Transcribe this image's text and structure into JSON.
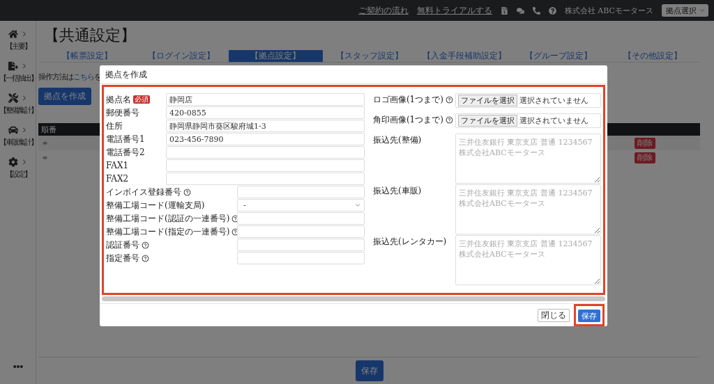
{
  "header": {
    "links": [
      "ご契約の流れ",
      "無料トライアルする"
    ],
    "company": "株式会社 ABCモータース",
    "branch_select": "拠点選択"
  },
  "sidebar": {
    "items": [
      {
        "kind": "home",
        "label": "【主要】"
      },
      {
        "kind": "export",
        "label": "【一括抽出】"
      },
      {
        "kind": "repair",
        "label": "【整備集計】"
      },
      {
        "kind": "car",
        "label": "【車販集計】"
      },
      {
        "kind": "settings",
        "label": "【設定】"
      }
    ]
  },
  "page": {
    "title": "【共通設定】",
    "tabs": [
      {
        "label": "【帳票設定】",
        "selected": false
      },
      {
        "label": "【ログイン設定】",
        "selected": false
      },
      {
        "label": "【拠点設定】",
        "selected": true
      },
      {
        "label": "【スタッフ設定】",
        "selected": false
      },
      {
        "label": "【入金手段補助設定】",
        "selected": false
      },
      {
        "label": "【グループ設定】",
        "selected": false
      },
      {
        "label": "【その他設定】",
        "selected": false
      }
    ],
    "help": {
      "text": "操作方法は",
      "link": "こちら",
      "rest": "を"
    },
    "create_button": "拠点を作成",
    "table": {
      "columns": [
        "順番"
      ],
      "rows": [
        {
          "handle": "＝",
          "delete": "削除"
        },
        {
          "handle": "＝",
          "delete": "削除"
        }
      ]
    },
    "save_button": "保存"
  },
  "modal": {
    "title": "拠点を作成",
    "highlighted": true,
    "basic_fields": [
      {
        "kind": "text",
        "label": "拠点名",
        "required": "必須",
        "value": "静岡店"
      },
      {
        "kind": "text",
        "label": "郵便番号",
        "value": "420-0855"
      },
      {
        "kind": "text",
        "label": "住所",
        "value": "静岡県静岡市葵区駿府城1-3"
      },
      {
        "kind": "text",
        "label": "電話番号1",
        "value": "023-456-7890"
      },
      {
        "kind": "text",
        "label": "電話番号2"
      },
      {
        "kind": "text",
        "label": "FAX1"
      },
      {
        "kind": "text",
        "label": "FAX2"
      }
    ],
    "code_fields": [
      {
        "kind": "text",
        "label": "インボイス登録番号",
        "help": true
      },
      {
        "kind": "select",
        "label": "整備工場コード(運輸支局)",
        "help": false,
        "value": "-"
      },
      {
        "kind": "text",
        "label": "整備工場コード(認証の一連番号)",
        "help": true
      },
      {
        "kind": "text",
        "label": "整備工場コード(指定の一連番号)",
        "help": true
      },
      {
        "kind": "text",
        "label": "認証番号",
        "help": true
      },
      {
        "kind": "text",
        "label": "指定番号",
        "help": true
      }
    ],
    "right_fields": [
      {
        "kind": "file",
        "label": "ロゴ画像(1つまで)",
        "help": true,
        "button": "ファイルを選択",
        "status": "選択されていません"
      },
      {
        "kind": "file",
        "label": "角印画像(1つまで)",
        "help": true,
        "button": "ファイルを選択",
        "status": "選択されていません"
      },
      {
        "kind": "textarea",
        "label": "振込先(整備)",
        "help": false,
        "placeholder": "三井住友銀行 東京支店 普通 1234567 株式会社ABCモータース"
      },
      {
        "kind": "textarea",
        "label": "振込先(車販)",
        "help": false,
        "placeholder": "三井住友銀行 東京支店 普通 1234567 株式会社ABCモータース"
      },
      {
        "kind": "textarea",
        "label": "振込先(レンタカー)",
        "help": false,
        "placeholder": "三井住友銀行 東京支店 普通 1234567 株式会社ABCモータース"
      }
    ],
    "buttons": {
      "close": "閉じる",
      "save": "保存",
      "save_highlighted": true
    }
  }
}
